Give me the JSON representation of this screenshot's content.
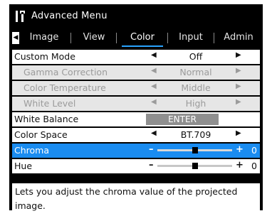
{
  "title": "Advanced Menu",
  "icon": "tools-icon",
  "tabs": [
    {
      "label": "Image",
      "active": false
    },
    {
      "label": "View",
      "active": false
    },
    {
      "label": "Color",
      "active": true
    },
    {
      "label": "Input",
      "active": false
    },
    {
      "label": "Admin",
      "active": false
    }
  ],
  "rows": {
    "custom_mode": {
      "label": "Custom Mode",
      "value": "Off"
    },
    "gamma": {
      "label": "Gamma Correction",
      "value": "Normal"
    },
    "color_temp": {
      "label": "Color Temperature",
      "value": "Middle"
    },
    "white_level": {
      "label": "White Level",
      "value": "High"
    },
    "white_balance": {
      "label": "White Balance",
      "button": "ENTER"
    },
    "color_space": {
      "label": "Color Space",
      "value": "BT.709"
    },
    "chroma": {
      "label": "Chroma",
      "value": "0",
      "level": 0.5
    },
    "hue": {
      "label": "Hue",
      "value": "0",
      "level": 0.5
    }
  },
  "help_text": "Lets you adjust the chroma value of the projected image.",
  "colors": {
    "selection": "#1a8cf0",
    "active_tab_underline": "#2aa4ff"
  }
}
